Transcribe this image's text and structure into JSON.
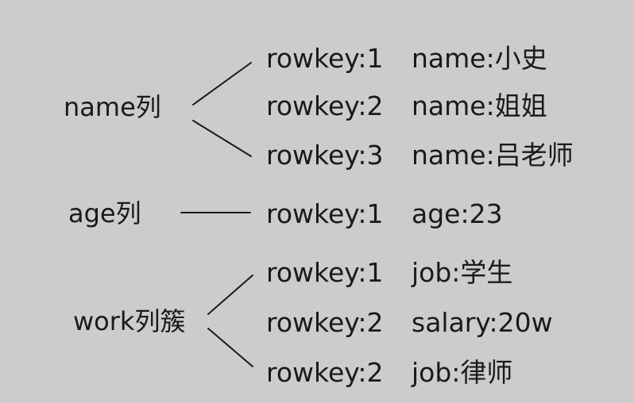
{
  "groups": [
    {
      "label": "name列",
      "rows": [
        {
          "key": "rowkey:1",
          "value": "name:小史"
        },
        {
          "key": "rowkey:2",
          "value": "name:姐姐"
        },
        {
          "key": "rowkey:3",
          "value": "name:吕老师"
        }
      ]
    },
    {
      "label": "age列",
      "rows": [
        {
          "key": "rowkey:1",
          "value": "age:23"
        }
      ]
    },
    {
      "label": "work列簇",
      "rows": [
        {
          "key": "rowkey:1",
          "value": "job:学生"
        },
        {
          "key": "rowkey:2",
          "value": "salary:20w"
        },
        {
          "key": "rowkey:2",
          "value": "job:律师"
        }
      ]
    }
  ],
  "colors": {
    "background": "#cccccc",
    "text": "#1a1a1a",
    "line": "#1a1a1a"
  }
}
